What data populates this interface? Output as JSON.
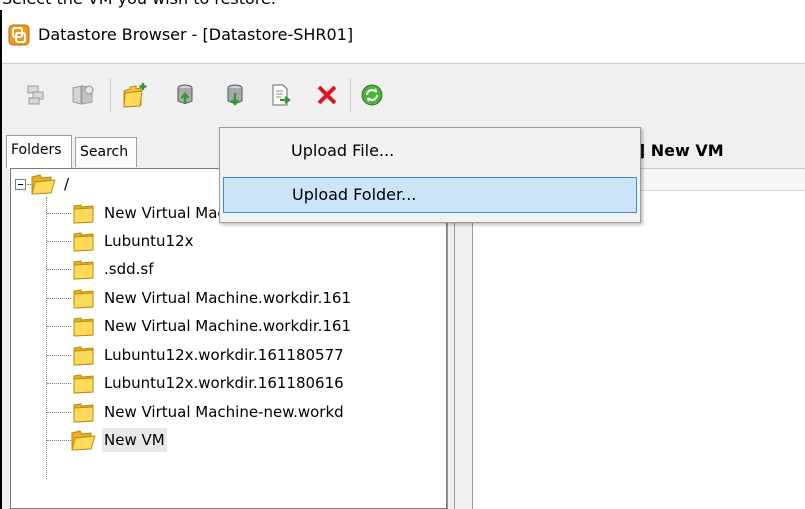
{
  "caption": "Select the VM you wish to restore.",
  "window": {
    "title": "Datastore Browser - [Datastore-SHR01]"
  },
  "toolbar": {
    "buttons": [
      {
        "icon": "datastore-browse-icon"
      },
      {
        "icon": "datastore-search-icon"
      },
      {
        "icon": "new-folder-icon"
      },
      {
        "icon": "upload-icon"
      },
      {
        "icon": "download-icon"
      },
      {
        "icon": "register-vm-icon"
      },
      {
        "icon": "delete-icon"
      },
      {
        "icon": "refresh-icon"
      }
    ]
  },
  "tabs": {
    "folders": "Folders",
    "search": "Search"
  },
  "tree": {
    "root": "/",
    "items": [
      {
        "label": "New Virtual Machine.workdir.161"
      },
      {
        "label": "Lubuntu12x"
      },
      {
        "label": ".sdd.sf"
      },
      {
        "label": "New Virtual Machine.workdir.161"
      },
      {
        "label": "New Virtual Machine.workdir.161"
      },
      {
        "label": "Lubuntu12x.workdir.161180577"
      },
      {
        "label": "Lubuntu12x.workdir.161180616"
      },
      {
        "label": "New Virtual Machine-new.workd"
      },
      {
        "label": "New VM"
      }
    ]
  },
  "detail": {
    "header": "[Datastore-SHR01] New VM"
  },
  "context_menu": {
    "items": [
      {
        "label": "Upload File..."
      },
      {
        "label": "Upload Folder..."
      }
    ]
  },
  "colors": {
    "highlight_bg": "#cce4f7",
    "highlight_border": "#3a8fd6",
    "folder_yellow": "#f6c73c",
    "delete_red": "#e0141e",
    "refresh_green": "#4bb33a"
  }
}
